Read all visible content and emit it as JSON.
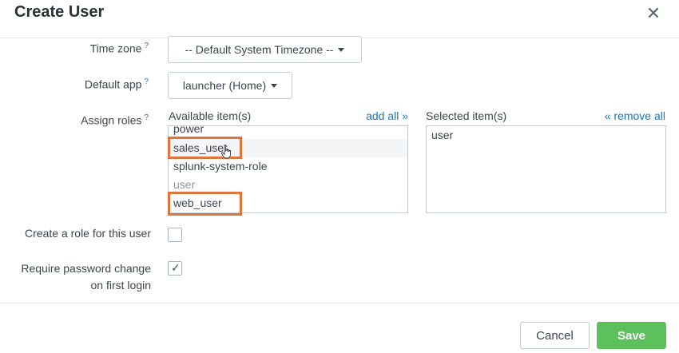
{
  "modal": {
    "title": "Create User",
    "close_glyph": "✕"
  },
  "form": {
    "timezone": {
      "label": "Time zone",
      "help": "?",
      "value": "-- Default System Timezone --"
    },
    "default_app": {
      "label": "Default app",
      "help": "?",
      "value": "launcher (Home)"
    },
    "roles": {
      "label": "Assign roles",
      "help": "?",
      "available_header": "Available item(s)",
      "add_all": "add all »",
      "selected_header": "Selected item(s)",
      "remove_all": "« remove all",
      "available_items": [
        {
          "label": "power",
          "state": "normal"
        },
        {
          "label": "sales_user",
          "state": "highlighted"
        },
        {
          "label": "splunk-system-role",
          "state": "normal"
        },
        {
          "label": "user",
          "state": "selected-elsewhere"
        },
        {
          "label": "web_user",
          "state": "highlighted"
        }
      ],
      "selected_items": [
        "user"
      ]
    },
    "create_role": {
      "label": "Create a role for this user",
      "checked": false
    },
    "require_password_change": {
      "label_line1": "Require password change",
      "label_line2": "on first login",
      "checked": true,
      "check_glyph": "✓"
    }
  },
  "footer": {
    "cancel_label": "Cancel",
    "save_label": "Save"
  },
  "colors": {
    "accent_link": "#1a75b8",
    "highlight_border": "#e0743d",
    "save_button": "#5cc05c"
  },
  "icons": {
    "close": "close-icon",
    "caret": "caret-down-icon",
    "cursor": "hand-pointer-icon",
    "check": "checkmark-icon"
  }
}
